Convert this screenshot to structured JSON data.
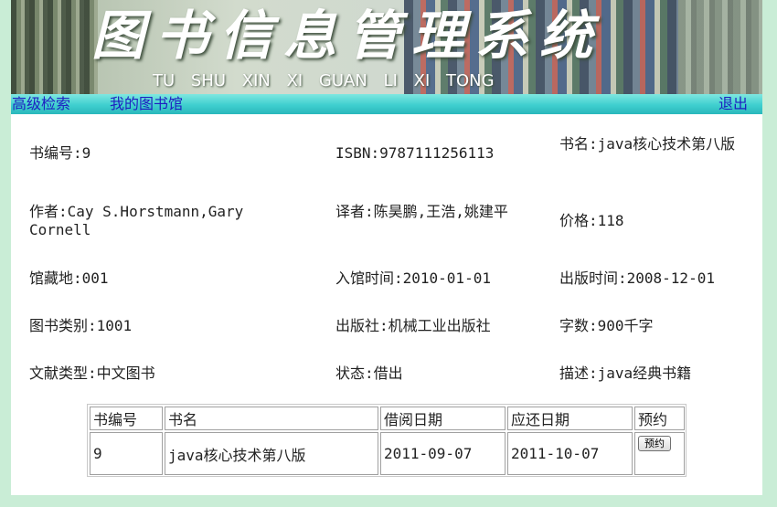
{
  "banner": {
    "title": "图书信息管理系统",
    "subtitle": "TU SHU XIN XI GUAN LI XI TONG"
  },
  "nav": {
    "advanced_search": "高级检索",
    "my_library": "我的图书馆",
    "logout": "退出"
  },
  "book": {
    "book_no": "书编号:9",
    "isbn": "ISBN:9787111256113",
    "title": "书名:java核心技术第八版",
    "author": "作者:Cay S.Horstmann,Gary Cornell",
    "translator": "译者:陈昊鹏,王浩,姚建平",
    "price": "价格:118",
    "location": "馆藏地:001",
    "entry_date": "入馆时间:2010-01-01",
    "publish_date": "出版时间:2008-12-01",
    "category": "图书类别:1001",
    "publisher": "出版社:机械工业出版社",
    "word_count": "字数:900千字",
    "doc_type": "文献类型:中文图书",
    "status": "状态:借出",
    "description": "描述:java经典书籍"
  },
  "table": {
    "headers": [
      "书编号",
      "书名",
      "借阅日期",
      "应还日期",
      "预约"
    ],
    "rows": [
      {
        "book_no": "9",
        "title": "java核心技术第八版",
        "borrow_date": "2011-09-07",
        "due_date": "2011-10-07",
        "action": "预约"
      }
    ]
  }
}
